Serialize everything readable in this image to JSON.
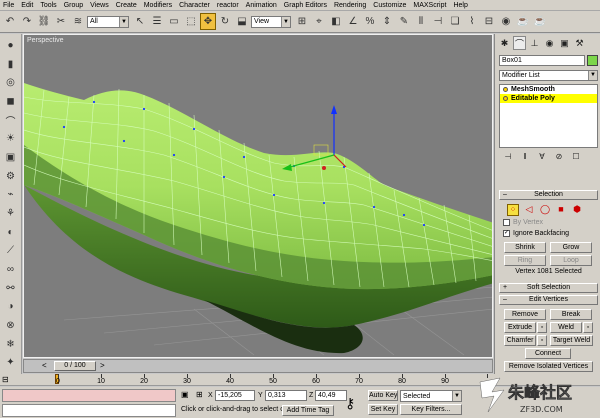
{
  "menu": [
    "File",
    "Edit",
    "Tools",
    "Group",
    "Views",
    "Create",
    "Modifiers",
    "Character",
    "reactor",
    "Animation",
    "Graph Editors",
    "Rendering",
    "Customize",
    "MAXScript",
    "Help"
  ],
  "toolbar": {
    "icons_left": [
      "undo-icon",
      "redo-icon",
      "select-link-icon",
      "unlink-icon",
      "bind-space-warp-icon"
    ],
    "filter_value": "All",
    "icons_mid": [
      "select-object-icon",
      "select-by-name-icon",
      "rect-region-icon",
      "select-move-icon",
      "select-rotate-icon",
      "select-scale-icon"
    ],
    "coord_value": "View",
    "icons_right": [
      "pivot-icon",
      "mirror-icon",
      "align-icon",
      "snaps-icon",
      "angle-snap-icon",
      "percent-snap-icon",
      "spinner-snap-icon",
      "named-sel-icon",
      "layer-icon",
      "curve-editor-icon",
      "schematic-icon",
      "material-editor-icon",
      "render-scene-icon",
      "quick-render-icon",
      "render-type-icon"
    ]
  },
  "left_toolbar_icons": [
    "sphere-icon",
    "cylinder-icon",
    "torus-icon",
    "box-icon",
    "shape-icon",
    "light-icon",
    "camera-icon",
    "helper-icon",
    "spacewarp-icon",
    "system-icon",
    "material-icon",
    "bone-icon",
    "link-icon",
    "chain-icon",
    "display-icon",
    "hide-icon",
    "freeze-icon",
    "utility-icon",
    "reactor-icon"
  ],
  "viewport": {
    "label": "Perspective"
  },
  "command_panel": {
    "tabs": [
      "create-tab-icon",
      "modify-tab-icon",
      "hierarchy-tab-icon",
      "motion-tab-icon",
      "display-tab-icon",
      "utilities-tab-icon"
    ],
    "object_name": "Box01",
    "object_color": "#7cd64a",
    "modifier_list": "Modifier List",
    "stack": [
      {
        "label": "MeshSmooth",
        "selected": false
      },
      {
        "label": "Editable Poly",
        "selected": true
      }
    ],
    "selection": {
      "title": "Selection",
      "by_vertex": "By Vertex",
      "ignore_backfacing": "Ignore Backfacing",
      "shrink": "Shrink",
      "grow": "Grow",
      "ring": "Ring",
      "loop": "Loop",
      "status": "Vertex 1081 Selected"
    },
    "soft_selection": {
      "title": "Soft Selection"
    },
    "edit_vertices": {
      "title": "Edit Vertices",
      "remove": "Remove",
      "break": "Break",
      "extrude": "Extrude",
      "weld": "Weld",
      "chamfer": "Chamfer",
      "target_weld": "Target Weld",
      "connect": "Connect",
      "remove_isolated": "Remove Isolated Vertices"
    }
  },
  "timeline": {
    "slider": "0 / 100",
    "current_frame": 0,
    "total_frames": 100
  },
  "trackbar": {
    "ticks": [
      "0",
      "10",
      "20",
      "30",
      "40",
      "50",
      "60",
      "70",
      "80",
      "90",
      "100"
    ]
  },
  "status": {
    "x": "-15,205",
    "y": "0,313",
    "z": "40,49",
    "prompt": "Click or click-and-drag to select ob",
    "add_time_tag": "Add Time Tag",
    "auto_key": "Auto Key",
    "set_key": "Set Key",
    "key_selected": "Selected",
    "key_filters": "Key Filters..."
  },
  "watermark": {
    "text": "朱峰社区",
    "sub": "ZF3D.COM"
  }
}
